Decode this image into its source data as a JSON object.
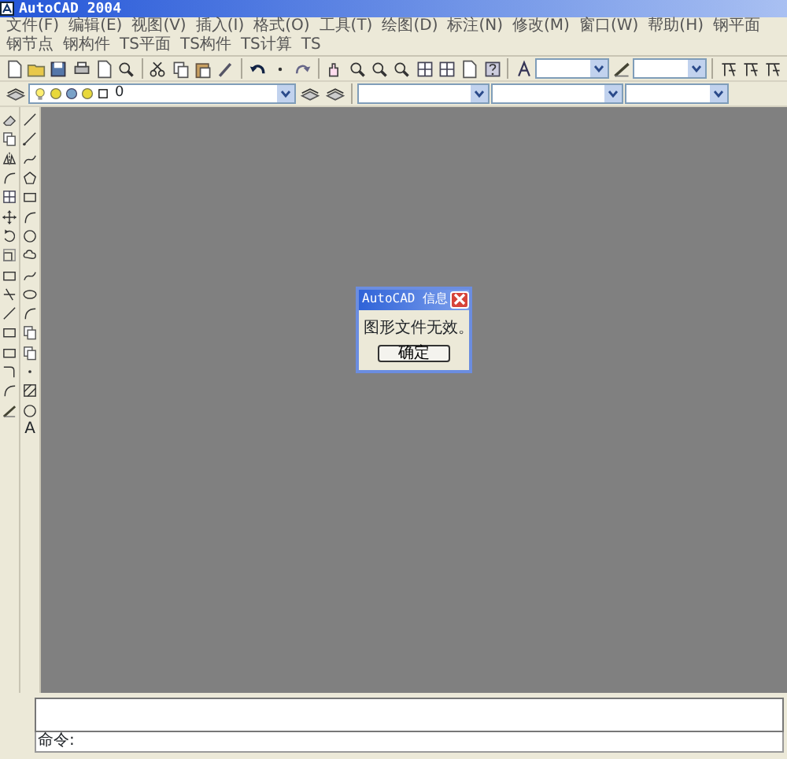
{
  "window": {
    "title": "AutoCAD 2004"
  },
  "menu": [
    {
      "label": "文件(F)"
    },
    {
      "label": "编辑(E)"
    },
    {
      "label": "视图(V)"
    },
    {
      "label": "插入(I)"
    },
    {
      "label": "格式(O)"
    },
    {
      "label": "工具(T)"
    },
    {
      "label": "绘图(D)"
    },
    {
      "label": "标注(N)"
    },
    {
      "label": "修改(M)"
    },
    {
      "label": "窗口(W)"
    },
    {
      "label": "帮助(H)"
    },
    {
      "label": "钢平面"
    },
    {
      "label": "钢节点"
    },
    {
      "label": "钢构件"
    },
    {
      "label": "TS平面"
    },
    {
      "label": "TS构件"
    },
    {
      "label": "TS计算"
    },
    {
      "label": "TS"
    }
  ],
  "layer_toolbar": {
    "layer": "0"
  },
  "draw_toolbar": {
    "text_tool": "A"
  },
  "dialog": {
    "title": "AutoCAD 信息",
    "message": "图形文件无效。",
    "button": "确定"
  },
  "command_line": {
    "prompt": "命令:"
  }
}
